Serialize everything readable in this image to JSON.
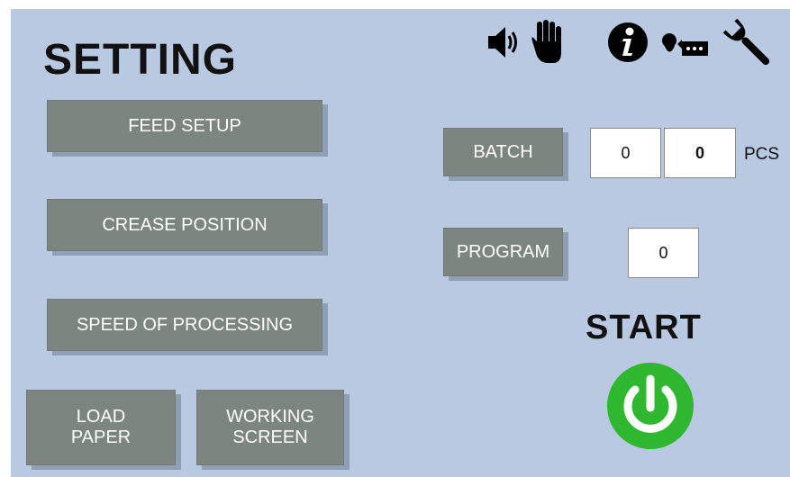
{
  "page": {
    "title": "SETTING"
  },
  "menu": {
    "feed_setup": "FEED SETUP",
    "crease_position": "CREASE POSITION",
    "speed_of_processing": "SPEED OF PROCESSING",
    "load_paper": "LOAD\nPAPER",
    "working_screen": "WORKING\nSCREEN"
  },
  "toolbar_icons": [
    "speaker-icon",
    "hand-stop-icon",
    "info-icon",
    "message-icon",
    "wrench-icon"
  ],
  "batch": {
    "button_label": "BATCH",
    "value_1": "0",
    "value_2": "0",
    "unit": "PCS"
  },
  "program": {
    "button_label": "PROGRAM",
    "value": "0"
  },
  "start": {
    "label": "START",
    "icon": "power-icon",
    "color": "#2fb82f"
  },
  "colors": {
    "background": "#b9c9e2",
    "button": "#7c8580"
  }
}
